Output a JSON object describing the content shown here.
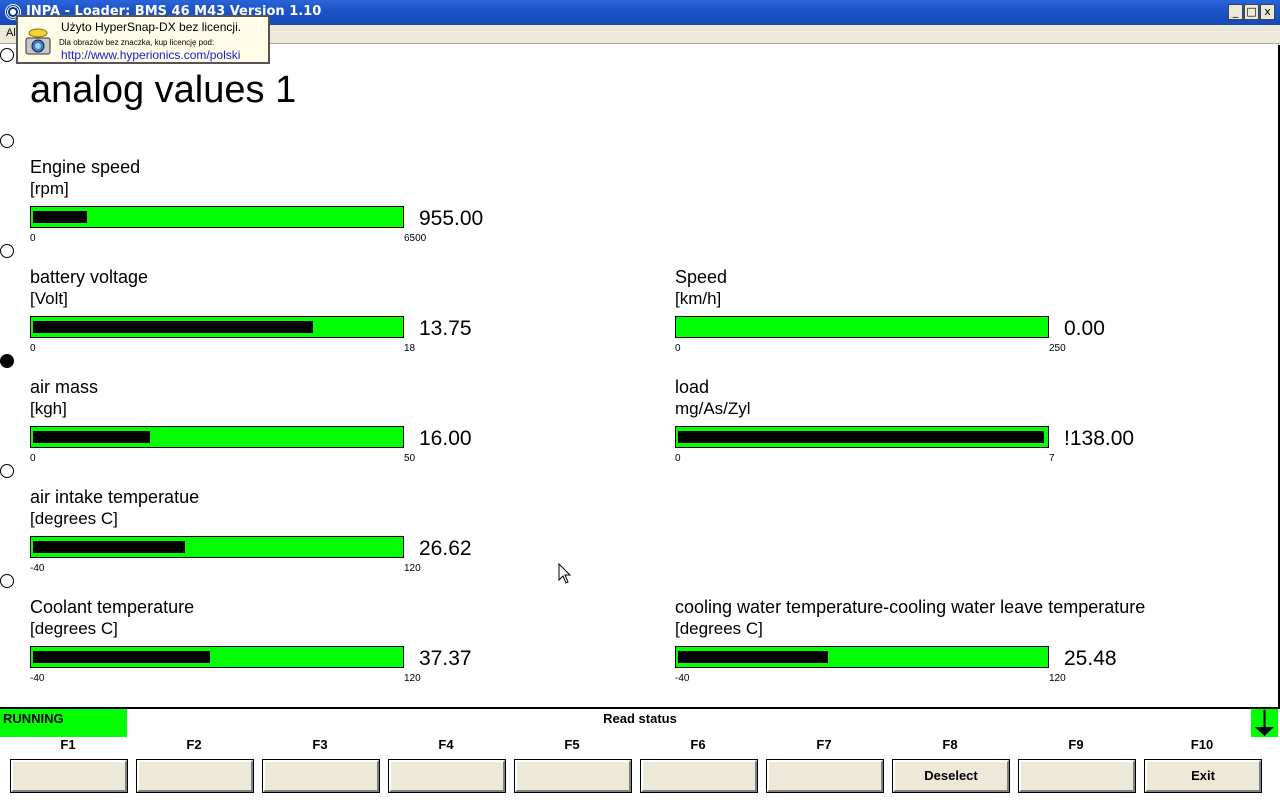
{
  "window": {
    "title": "INPA - Loader:  BMS 46 M43 Version 1.10",
    "minimize": "_",
    "maximize": "□",
    "close": "x"
  },
  "menu": {
    "first_item": "Al"
  },
  "hypersnap": {
    "line1": "Użyto HyperSnap-DX bez licencji.",
    "line2": "Dla obrazów bez znaczka, kup licencję pod:",
    "line3": "http://www.hyperionics.com/polski"
  },
  "page": {
    "title": "analog values 1"
  },
  "gauges": [
    {
      "label": "Engine speed",
      "unit": "[rpm]",
      "min": "0",
      "max": "6500",
      "value": "955.00",
      "fraction": 0.147
    },
    {
      "label": "battery voltage",
      "unit": "[Volt]",
      "min": "0",
      "max": "18",
      "value": "13.75",
      "fraction": 0.764
    },
    {
      "label": "Speed",
      "unit": "[km/h]",
      "min": "0",
      "max": "250",
      "value": "0.00",
      "fraction": 0.0
    },
    {
      "label": "air mass",
      "unit": "[kgh]",
      "min": "0",
      "max": "50",
      "value": "16.00",
      "fraction": 0.32
    },
    {
      "label": "load",
      "unit": "mg/As/Zyl",
      "min": "0",
      "max": "7",
      "value": "!138.00",
      "fraction": 1.0
    },
    {
      "label": "air intake temperatue",
      "unit": "[degrees C]",
      "min": "-40",
      "max": "120",
      "value": "26.62",
      "fraction": 0.416
    },
    {
      "label": "Coolant temperature",
      "unit": "[degrees C]",
      "min": "-40",
      "max": "120",
      "value": "37.37",
      "fraction": 0.483
    },
    {
      "label": "cooling water temperature-cooling water leave temperature",
      "unit": "[degrees C]",
      "min": "-40",
      "max": "120",
      "value": "25.48",
      "fraction": 0.409
    }
  ],
  "status": {
    "state": "RUNNING",
    "text": "Read status"
  },
  "fkeys": [
    {
      "key": "F1",
      "label": ""
    },
    {
      "key": "F2",
      "label": ""
    },
    {
      "key": "F3",
      "label": ""
    },
    {
      "key": "F4",
      "label": ""
    },
    {
      "key": "F5",
      "label": ""
    },
    {
      "key": "F6",
      "label": ""
    },
    {
      "key": "F7",
      "label": ""
    },
    {
      "key": "F8",
      "label": "Deselect"
    },
    {
      "key": "F9",
      "label": ""
    },
    {
      "key": "F10",
      "label": "Exit"
    }
  ],
  "colors": {
    "bar_background": "#00ff00",
    "bar_fill": "#000000",
    "status_running": "#00ff00",
    "titlebar": "#1c54c8"
  },
  "icons": [
    "inpa-app-icon",
    "camera-icon",
    "arrow-down-icon",
    "mouse-cursor-icon"
  ]
}
